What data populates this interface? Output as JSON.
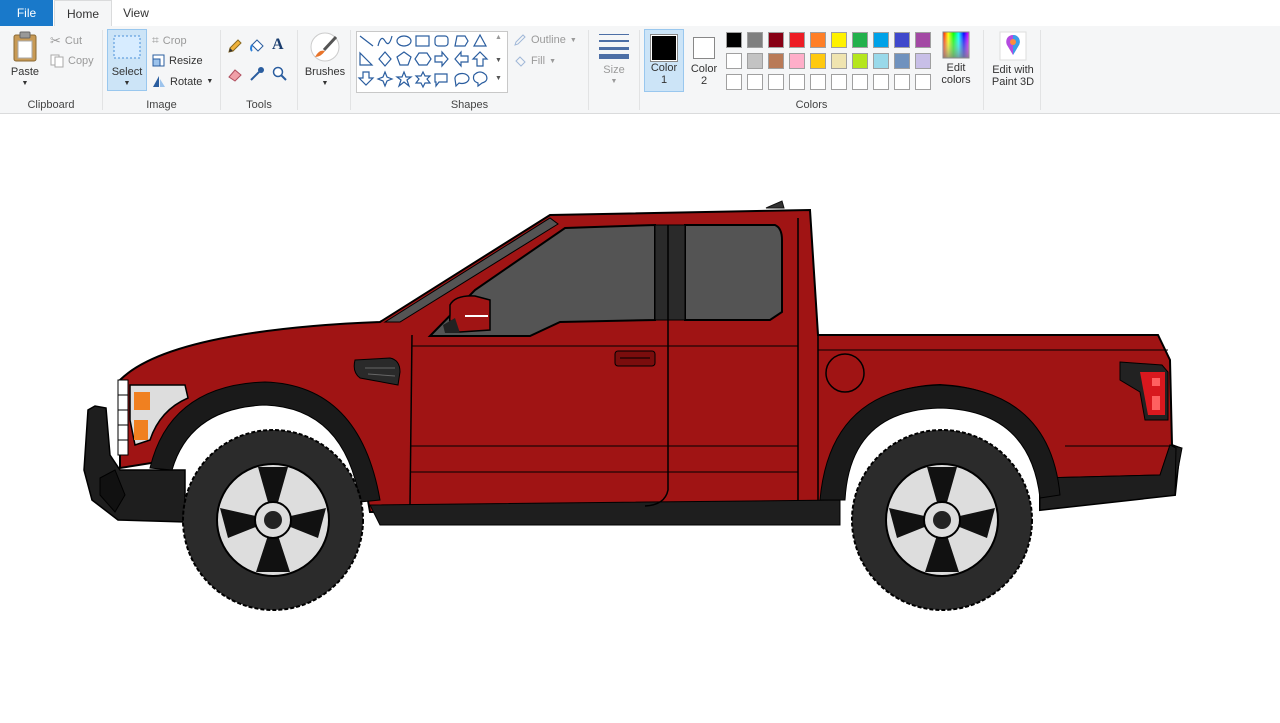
{
  "tabs": {
    "file": "File",
    "home": "Home",
    "view": "View"
  },
  "clipboard": {
    "paste": "Paste",
    "cut": "Cut",
    "copy": "Copy",
    "label": "Clipboard"
  },
  "image": {
    "select": "Select",
    "crop": "Crop",
    "resize": "Resize",
    "rotate": "Rotate",
    "label": "Image"
  },
  "tools": {
    "label": "Tools"
  },
  "brushes": {
    "label": "Brushes"
  },
  "shapes": {
    "outline": "Outline",
    "fill": "Fill",
    "label": "Shapes"
  },
  "size": {
    "label": "Size"
  },
  "colors": {
    "color1_label": "Color",
    "color1_num": "1",
    "color2_label": "Color",
    "color2_num": "2",
    "color1_value": "#000000",
    "color2_value": "#ffffff",
    "edit_colors_1": "Edit",
    "edit_colors_2": "colors",
    "label": "Colors",
    "palette_row1": [
      "#000000",
      "#7f7f7f",
      "#880015",
      "#ed1c24",
      "#ff7f27",
      "#fff200",
      "#22b14c",
      "#00a2e8",
      "#3f48cc",
      "#a349a4"
    ],
    "palette_row2": [
      "#ffffff",
      "#c3c3c3",
      "#b97a57",
      "#ffaec9",
      "#ffc90e",
      "#efe4b0",
      "#b5e61d",
      "#99d9ea",
      "#7092be",
      "#c8bfe7"
    ],
    "palette_row3": [
      "#ffffff",
      "#ffffff",
      "#ffffff",
      "#ffffff",
      "#ffffff",
      "#ffffff",
      "#ffffff",
      "#ffffff",
      "#ffffff",
      "#ffffff"
    ]
  },
  "paint3d": {
    "line1": "Edit with",
    "line2": "Paint 3D"
  },
  "canvas": {
    "drawing": "pickup-truck",
    "body_color": "#a01414",
    "tire_color": "#2b2b2b",
    "window_color": "#545454"
  }
}
